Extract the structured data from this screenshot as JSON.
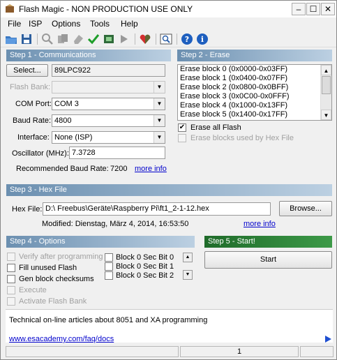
{
  "window": {
    "title": "Flash Magic - NON PRODUCTION USE ONLY"
  },
  "menu": [
    "File",
    "ISP",
    "Options",
    "Tools",
    "Help"
  ],
  "toolbar": {
    "icons": [
      "open-icon",
      "save-icon",
      "find-icon",
      "copy-icon",
      "erase-icon",
      "verify-icon",
      "program-icon",
      "go-icon",
      "hex-icon",
      "terminal-icon",
      "help-icon",
      "info-icon"
    ]
  },
  "step1": {
    "header": "Step 1 - Communications",
    "select_label": "Select...",
    "device": "89LPC922",
    "flash_bank_label": "Flash Bank:",
    "flash_bank_value": "",
    "com_port_label": "COM Port:",
    "com_port_value": "COM 3",
    "baud_label": "Baud Rate:",
    "baud_value": "4800",
    "interface_label": "Interface:",
    "interface_value": "None (ISP)",
    "osc_label": "Oscillator (MHz):",
    "osc_value": "7.3728",
    "rec_baud_label": "Recommended Baud Rate:",
    "rec_baud_value": "7200",
    "more_info": "more info"
  },
  "step2": {
    "header": "Step 2 - Erase",
    "blocks": [
      "Erase block 0 (0x0000-0x03FF)",
      "Erase block 1 (0x0400-0x07FF)",
      "Erase block 2 (0x0800-0x0BFF)",
      "Erase block 3 (0x0C00-0x0FFF)",
      "Erase block 4 (0x1000-0x13FF)",
      "Erase block 5 (0x1400-0x17FF)"
    ],
    "erase_all_label": "Erase all Flash",
    "erase_used_label": "Erase blocks used by Hex File"
  },
  "step3": {
    "header": "Step 3 - Hex File",
    "hex_label": "Hex File:",
    "hex_value": "D:\\ Freebus\\Geräte\\Raspberry Pi\\ft1_2-1-12.hex",
    "browse_label": "Browse...",
    "modified": "Modified: Dienstag, März 4, 2014, 16:53:50",
    "more_info": "more info"
  },
  "step4": {
    "header": "Step 4 - Options",
    "options": [
      {
        "label": "Verify after programming",
        "checked": false,
        "enabled": false
      },
      {
        "label": "Fill unused Flash",
        "checked": false,
        "enabled": true
      },
      {
        "label": "Gen block checksums",
        "checked": false,
        "enabled": true
      },
      {
        "label": "Execute",
        "checked": false,
        "enabled": false
      },
      {
        "label": "Activate Flash Bank",
        "checked": false,
        "enabled": false
      }
    ],
    "sec_bits": [
      "Block 0 Sec Bit 0",
      "Block 0 Sec Bit 1",
      "Block 0 Sec Bit 2"
    ]
  },
  "step5": {
    "header": "Step 5 - Start!",
    "start_label": "Start"
  },
  "info": {
    "text": "Technical on-line articles about 8051 and XA programming",
    "url": "www.esacademy.com/faq/docs"
  },
  "status": {
    "pane_value": "1"
  },
  "colors": {
    "step_header": "#6b8fb0",
    "step5_header": "#2e7d32",
    "link": "#0000cc"
  }
}
